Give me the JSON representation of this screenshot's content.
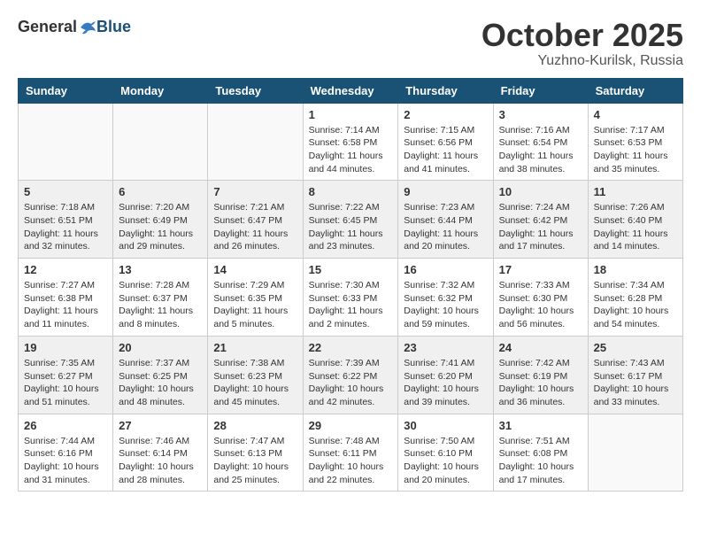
{
  "header": {
    "logo_general": "General",
    "logo_blue": "Blue",
    "month_title": "October 2025",
    "location": "Yuzhno-Kurilsk, Russia"
  },
  "days_of_week": [
    "Sunday",
    "Monday",
    "Tuesday",
    "Wednesday",
    "Thursday",
    "Friday",
    "Saturday"
  ],
  "weeks": [
    [
      {
        "day": "",
        "info": ""
      },
      {
        "day": "",
        "info": ""
      },
      {
        "day": "",
        "info": ""
      },
      {
        "day": "1",
        "info": "Sunrise: 7:14 AM\nSunset: 6:58 PM\nDaylight: 11 hours and 44 minutes."
      },
      {
        "day": "2",
        "info": "Sunrise: 7:15 AM\nSunset: 6:56 PM\nDaylight: 11 hours and 41 minutes."
      },
      {
        "day": "3",
        "info": "Sunrise: 7:16 AM\nSunset: 6:54 PM\nDaylight: 11 hours and 38 minutes."
      },
      {
        "day": "4",
        "info": "Sunrise: 7:17 AM\nSunset: 6:53 PM\nDaylight: 11 hours and 35 minutes."
      }
    ],
    [
      {
        "day": "5",
        "info": "Sunrise: 7:18 AM\nSunset: 6:51 PM\nDaylight: 11 hours and 32 minutes."
      },
      {
        "day": "6",
        "info": "Sunrise: 7:20 AM\nSunset: 6:49 PM\nDaylight: 11 hours and 29 minutes."
      },
      {
        "day": "7",
        "info": "Sunrise: 7:21 AM\nSunset: 6:47 PM\nDaylight: 11 hours and 26 minutes."
      },
      {
        "day": "8",
        "info": "Sunrise: 7:22 AM\nSunset: 6:45 PM\nDaylight: 11 hours and 23 minutes."
      },
      {
        "day": "9",
        "info": "Sunrise: 7:23 AM\nSunset: 6:44 PM\nDaylight: 11 hours and 20 minutes."
      },
      {
        "day": "10",
        "info": "Sunrise: 7:24 AM\nSunset: 6:42 PM\nDaylight: 11 hours and 17 minutes."
      },
      {
        "day": "11",
        "info": "Sunrise: 7:26 AM\nSunset: 6:40 PM\nDaylight: 11 hours and 14 minutes."
      }
    ],
    [
      {
        "day": "12",
        "info": "Sunrise: 7:27 AM\nSunset: 6:38 PM\nDaylight: 11 hours and 11 minutes."
      },
      {
        "day": "13",
        "info": "Sunrise: 7:28 AM\nSunset: 6:37 PM\nDaylight: 11 hours and 8 minutes."
      },
      {
        "day": "14",
        "info": "Sunrise: 7:29 AM\nSunset: 6:35 PM\nDaylight: 11 hours and 5 minutes."
      },
      {
        "day": "15",
        "info": "Sunrise: 7:30 AM\nSunset: 6:33 PM\nDaylight: 11 hours and 2 minutes."
      },
      {
        "day": "16",
        "info": "Sunrise: 7:32 AM\nSunset: 6:32 PM\nDaylight: 10 hours and 59 minutes."
      },
      {
        "day": "17",
        "info": "Sunrise: 7:33 AM\nSunset: 6:30 PM\nDaylight: 10 hours and 56 minutes."
      },
      {
        "day": "18",
        "info": "Sunrise: 7:34 AM\nSunset: 6:28 PM\nDaylight: 10 hours and 54 minutes."
      }
    ],
    [
      {
        "day": "19",
        "info": "Sunrise: 7:35 AM\nSunset: 6:27 PM\nDaylight: 10 hours and 51 minutes."
      },
      {
        "day": "20",
        "info": "Sunrise: 7:37 AM\nSunset: 6:25 PM\nDaylight: 10 hours and 48 minutes."
      },
      {
        "day": "21",
        "info": "Sunrise: 7:38 AM\nSunset: 6:23 PM\nDaylight: 10 hours and 45 minutes."
      },
      {
        "day": "22",
        "info": "Sunrise: 7:39 AM\nSunset: 6:22 PM\nDaylight: 10 hours and 42 minutes."
      },
      {
        "day": "23",
        "info": "Sunrise: 7:41 AM\nSunset: 6:20 PM\nDaylight: 10 hours and 39 minutes."
      },
      {
        "day": "24",
        "info": "Sunrise: 7:42 AM\nSunset: 6:19 PM\nDaylight: 10 hours and 36 minutes."
      },
      {
        "day": "25",
        "info": "Sunrise: 7:43 AM\nSunset: 6:17 PM\nDaylight: 10 hours and 33 minutes."
      }
    ],
    [
      {
        "day": "26",
        "info": "Sunrise: 7:44 AM\nSunset: 6:16 PM\nDaylight: 10 hours and 31 minutes."
      },
      {
        "day": "27",
        "info": "Sunrise: 7:46 AM\nSunset: 6:14 PM\nDaylight: 10 hours and 28 minutes."
      },
      {
        "day": "28",
        "info": "Sunrise: 7:47 AM\nSunset: 6:13 PM\nDaylight: 10 hours and 25 minutes."
      },
      {
        "day": "29",
        "info": "Sunrise: 7:48 AM\nSunset: 6:11 PM\nDaylight: 10 hours and 22 minutes."
      },
      {
        "day": "30",
        "info": "Sunrise: 7:50 AM\nSunset: 6:10 PM\nDaylight: 10 hours and 20 minutes."
      },
      {
        "day": "31",
        "info": "Sunrise: 7:51 AM\nSunset: 6:08 PM\nDaylight: 10 hours and 17 minutes."
      },
      {
        "day": "",
        "info": ""
      }
    ]
  ]
}
